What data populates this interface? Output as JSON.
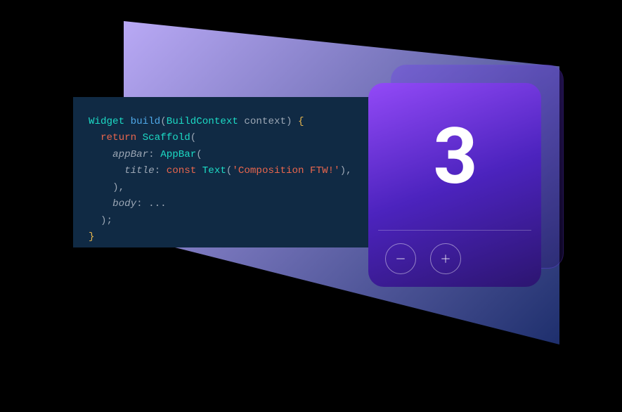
{
  "colors": {
    "code_bg": "#102A44",
    "gradient_start": "#b9a9f5",
    "gradient_end": "#1e2f6d",
    "card_grad_a": "#934AF7",
    "card_grad_b": "#2C1570",
    "accent_border": "#6E3CF5"
  },
  "code": {
    "line1": {
      "type": "Widget",
      "func": "build",
      "paramType": "BuildContext",
      "paramName": "context"
    },
    "line2": {
      "kw": "return",
      "cls": "Scaffold"
    },
    "line3": {
      "prop": "appBar",
      "cls": "AppBar"
    },
    "line4": {
      "prop": "title",
      "kw": "const",
      "cls": "Text",
      "str": "'Composition FTW!'"
    },
    "line5": {
      "close": "),"
    },
    "line6": {
      "prop": "body",
      "dots": "..."
    },
    "line7": {
      "close": ");"
    },
    "line8": {
      "brace": "}"
    }
  },
  "counter": {
    "value": "3",
    "minus_icon": "minus-icon",
    "plus_icon": "plus-icon"
  }
}
